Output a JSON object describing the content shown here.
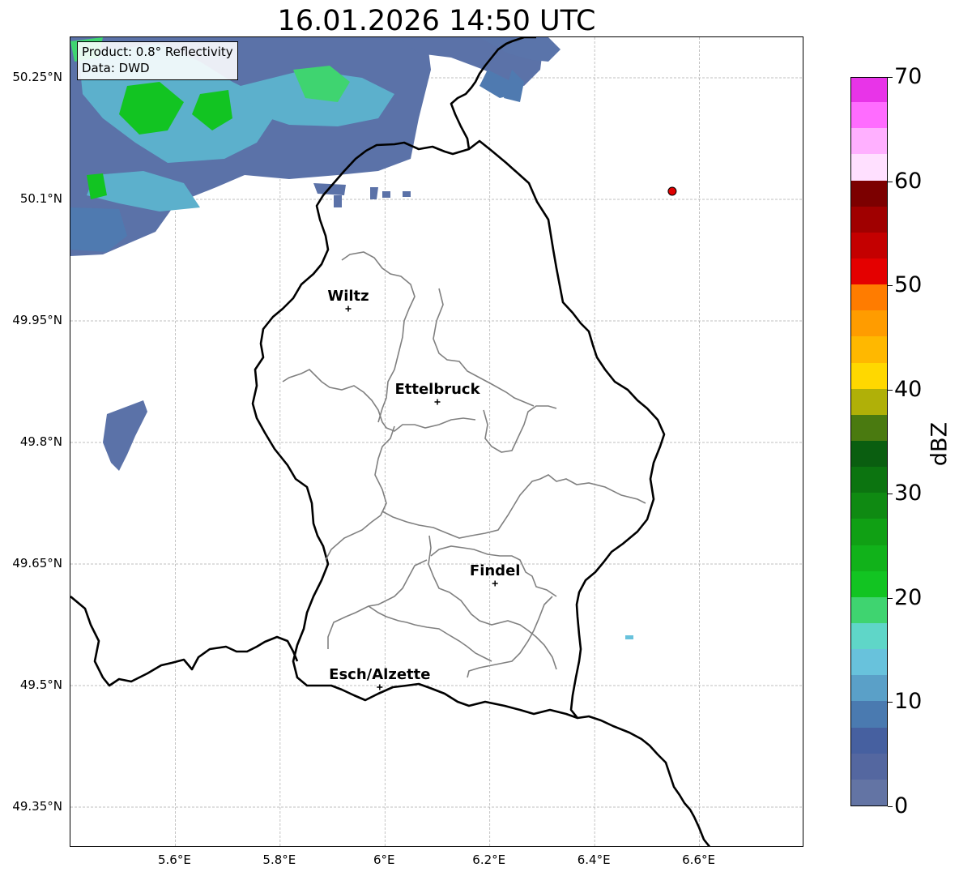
{
  "title": "16.01.2026 14:50 UTC",
  "info_box": {
    "product": "Product: 0.8° Reflectivity",
    "data": "Data: DWD"
  },
  "axes": {
    "lat_labels": [
      "50.25°N",
      "50.1°N",
      "49.95°N",
      "49.8°N",
      "49.65°N",
      "49.5°N",
      "49.35°N"
    ],
    "lat_values": [
      50.25,
      50.1,
      49.95,
      49.8,
      49.65,
      49.5,
      49.35
    ],
    "lon_labels": [
      "5.6°E",
      "5.8°E",
      "6°E",
      "6.2°E",
      "6.4°E",
      "6.6°E"
    ],
    "lon_values": [
      5.6,
      5.8,
      6.0,
      6.2,
      6.4,
      6.6
    ],
    "lon_range": [
      5.4,
      6.8
    ],
    "lat_range": [
      49.3,
      50.3
    ],
    "grid": true
  },
  "cities": [
    {
      "name": "Wiltz",
      "lon": 5.93,
      "lat": 49.965
    },
    {
      "name": "Ettelbruck",
      "lon": 6.1,
      "lat": 49.85
    },
    {
      "name": "Findel",
      "lon": 6.21,
      "lat": 49.626
    },
    {
      "name": "Esch/Alzette",
      "lon": 5.99,
      "lat": 49.498
    }
  ],
  "radar_site": {
    "lon": 6.548,
    "lat": 50.11,
    "color": "#e00000"
  },
  "colorbar": {
    "label": "dBZ",
    "ticks": [
      "0",
      "10",
      "20",
      "30",
      "40",
      "50",
      "60",
      "70"
    ],
    "tick_values": [
      0,
      10,
      20,
      30,
      40,
      50,
      60,
      70
    ],
    "min": 0,
    "max": 70,
    "colors": [
      "#6374a4",
      "#5467a0",
      "#4660a0",
      "#4a7ab0",
      "#5aa0c8",
      "#68c2dc",
      "#5fd6c8",
      "#3fd470",
      "#12c422",
      "#11b21a",
      "#10a014",
      "#0f8a12",
      "#0c7410",
      "#0a5e10",
      "#4a7a10",
      "#b0b008",
      "#ffd800",
      "#ffb800",
      "#ff9c00",
      "#ff7c00",
      "#e40000",
      "#c40000",
      "#a00000",
      "#7c0000",
      "#ffe0ff",
      "#ffb0ff",
      "#ff6cff",
      "#e834e8"
    ]
  }
}
